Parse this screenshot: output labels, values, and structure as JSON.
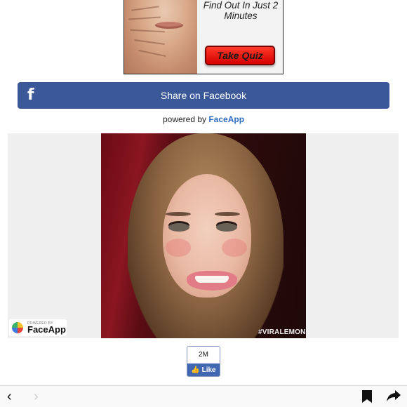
{
  "ad": {
    "headline": "Find Out In Just 2 Minutes",
    "button_label": "Take Quiz"
  },
  "share": {
    "icon": "facebook-f-icon",
    "label": "Share on Facebook",
    "color": "#3b5998"
  },
  "powered": {
    "prefix": "powered by ",
    "brand": "FaceApp"
  },
  "image": {
    "watermark": "#VIRALEMON",
    "badge_small": "POWERED BY",
    "badge_name": "FaceApp"
  },
  "like": {
    "count": "2M",
    "label": "Like"
  },
  "toolbar": {
    "back": "‹",
    "forward": "›",
    "share": "↪"
  }
}
